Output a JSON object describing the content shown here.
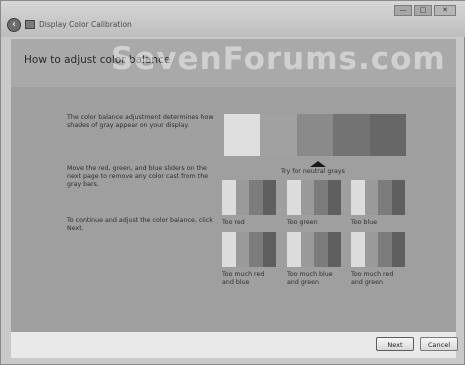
{
  "window": {
    "title": "Display Color Calibration",
    "controls": [
      "—",
      "□",
      "✕"
    ]
  },
  "header": {
    "title": "How to adjust color balance",
    "watermark": "SevenForums.com"
  },
  "content": {
    "paragraphs": [
      "The color balance adjustment determines how shades of gray appear on your display.",
      "Move the red, green, and blue sliders on the next page to remove any color cast from the gray bars.",
      "To continue and adjust the color balance, click Next."
    ],
    "reference_hint": "Try for neutral grays",
    "examples": [
      "Too red",
      "Too green",
      "Too blue",
      "Too much red and blue",
      "Too much blue and green",
      "Too much red and green"
    ]
  },
  "footer": {
    "next_label": "Next",
    "cancel_label": "Cancel"
  },
  "colors": {
    "header_bg": "#a9a9a9",
    "content_bg": "#9f9f9f",
    "ref_shades": [
      "#dedede",
      "#a1a1a1",
      "#8a8a8a",
      "#737373",
      "#676767"
    ],
    "thumb_shades": [
      "#dcdcdc",
      "#9a9a9a",
      "#7c7c7c",
      "#5f5f5f"
    ]
  }
}
